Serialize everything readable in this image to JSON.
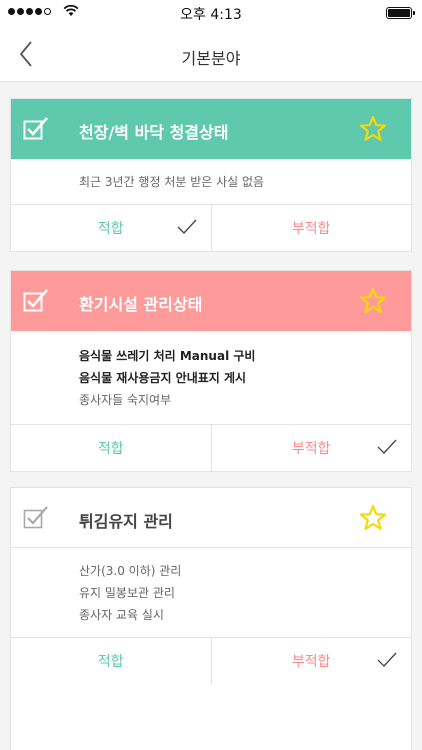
{
  "status_bar": {
    "time": "오후 4:13",
    "battery_level": 1.0
  },
  "nav": {
    "title": "기본분야"
  },
  "colors": {
    "green": "#5ec9ad",
    "red": "#ff9a9a",
    "star": "#f5d90a"
  },
  "cards": [
    {
      "title": "천장/벽 바닥 청결상태",
      "lines": [
        "최근 3년간 행정 처분 받은 사실 없음"
      ],
      "ok_label": "적합",
      "ng_label": "부적합"
    },
    {
      "title": "환기시설 관리상태",
      "lines": [
        "음식물 쓰레기 처리 Manual 구비",
        "음식물 재사용금지 안내표지 게시",
        "종사자들 숙지여부"
      ],
      "ok_label": "적합",
      "ng_label": "부적합"
    },
    {
      "title": "튀김유지 관리",
      "lines": [
        "산가(3.0 이하) 관리",
        "유지 밀봉보관 관리",
        "종사자 교육 실시"
      ],
      "ok_label": "적합",
      "ng_label": "부적합"
    }
  ]
}
